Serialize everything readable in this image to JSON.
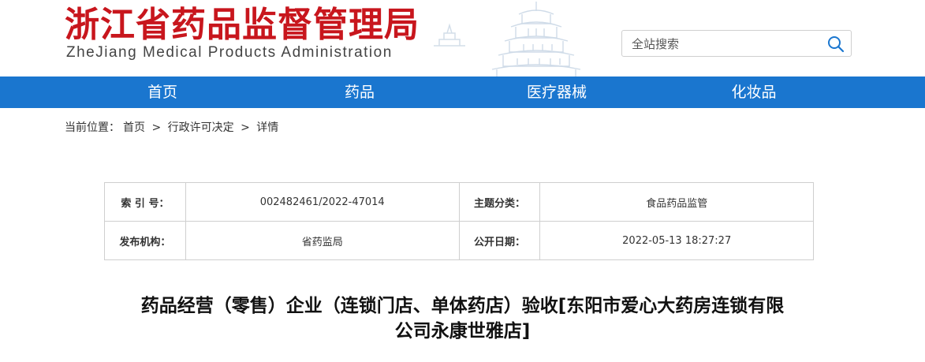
{
  "header": {
    "title": "浙江省药品监督管理局",
    "subtitle": "ZheJiang Medical Products Administration",
    "search_placeholder": "全站搜索"
  },
  "nav": {
    "items": [
      {
        "label": "首页"
      },
      {
        "label": "药品"
      },
      {
        "label": "医疗器械"
      },
      {
        "label": "化妆品"
      }
    ]
  },
  "breadcrumb": {
    "prefix": "当前位置：",
    "items": [
      "首页",
      "行政许可决定",
      "详情"
    ],
    "separator": ">"
  },
  "info": {
    "index_label": "索 引 号：",
    "index_value": "002482461/2022-47014",
    "category_label": "主题分类：",
    "category_value": "食品药品监管",
    "publisher_label": "发布机构：",
    "publisher_value": "省药监局",
    "date_label": "公开日期：",
    "date_value": "2022-05-13 18:27:27"
  },
  "article": {
    "title_line1": "药品经营（零售）企业（连锁门店、单体药店）验收[东阳市爱心大药房连锁有限",
    "title_line2": "公司永康世雅店]"
  },
  "colors": {
    "brand_red": "#c8161d",
    "nav_blue": "#1a76cf"
  }
}
